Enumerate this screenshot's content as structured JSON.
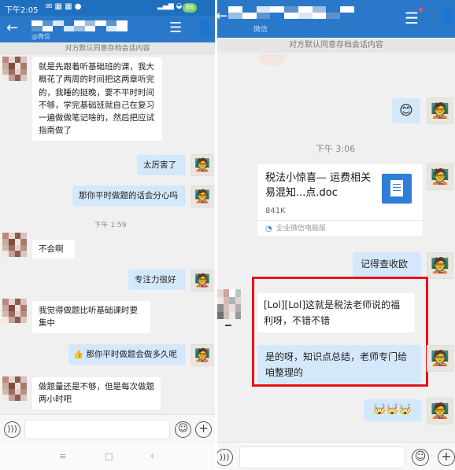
{
  "left": {
    "status": {
      "time": "下午2:05",
      "battery": "86"
    },
    "header": {
      "subtitle": "@微信",
      "back_icon": "arrow-left",
      "menu_icon": "hamburger",
      "profile_icon": "person"
    },
    "notice": "对方默认同意存档会话内容",
    "messages": [
      {
        "from": "other",
        "text": "就是先跟着听基础班的课，我大概花了两周的时间把这两章听完的，我睡的挺晚，要不平时时间不够，学完基础班就自己在复习一遍做做笔记啥的，然后把应试指南做了"
      },
      {
        "from": "me",
        "text": "太厉害了"
      },
      {
        "from": "me",
        "text": "那你平时做题的话会分心吗"
      },
      {
        "from": "time",
        "text": "下午 1:59"
      },
      {
        "from": "other",
        "text": "不会啊"
      },
      {
        "from": "me",
        "text": "专注力很好"
      },
      {
        "from": "other",
        "text": "我觉得做题比听基础课时要集中"
      },
      {
        "from": "me",
        "text": "那你平时做题会做多久呢",
        "emoji": "thumbs-up"
      },
      {
        "from": "other",
        "text": "做题量还是不够，但是每次做题两小时吧"
      }
    ],
    "nav": {
      "menu_glyph": "≡",
      "home_glyph": "□",
      "back_glyph": "‹"
    }
  },
  "right": {
    "header": {
      "subtitle": "微信",
      "back_icon": "arrow-left",
      "menu_icon": "hamburger",
      "profile_icon": "person"
    },
    "notice": "对方默认同意存档会话内容",
    "messages": [
      {
        "from": "me",
        "type": "emoji",
        "text": "😊"
      },
      {
        "from": "time",
        "text": "下午 3:06"
      },
      {
        "from": "me",
        "type": "file",
        "title": "税法小惊喜— 运费相关易混知...点.doc",
        "size": "841K",
        "source": "企业微信电脑版"
      },
      {
        "from": "me",
        "text": "记得查收欧"
      },
      {
        "from": "other",
        "text": "[Lol][Lol]这就是税法老师说的福利呀，不错不错"
      },
      {
        "from": "me",
        "text": "是的呀，知识点总结，老师专门给咱整理的"
      },
      {
        "from": "me",
        "type": "emoji",
        "text": "🤯🤯🤯"
      }
    ],
    "highlight_color": "#e8121b"
  },
  "colors": {
    "header": "#2a78c9",
    "status": "#1f6fbf",
    "my_bubble": "#d4e8fb",
    "background": "#f0f0f0"
  }
}
